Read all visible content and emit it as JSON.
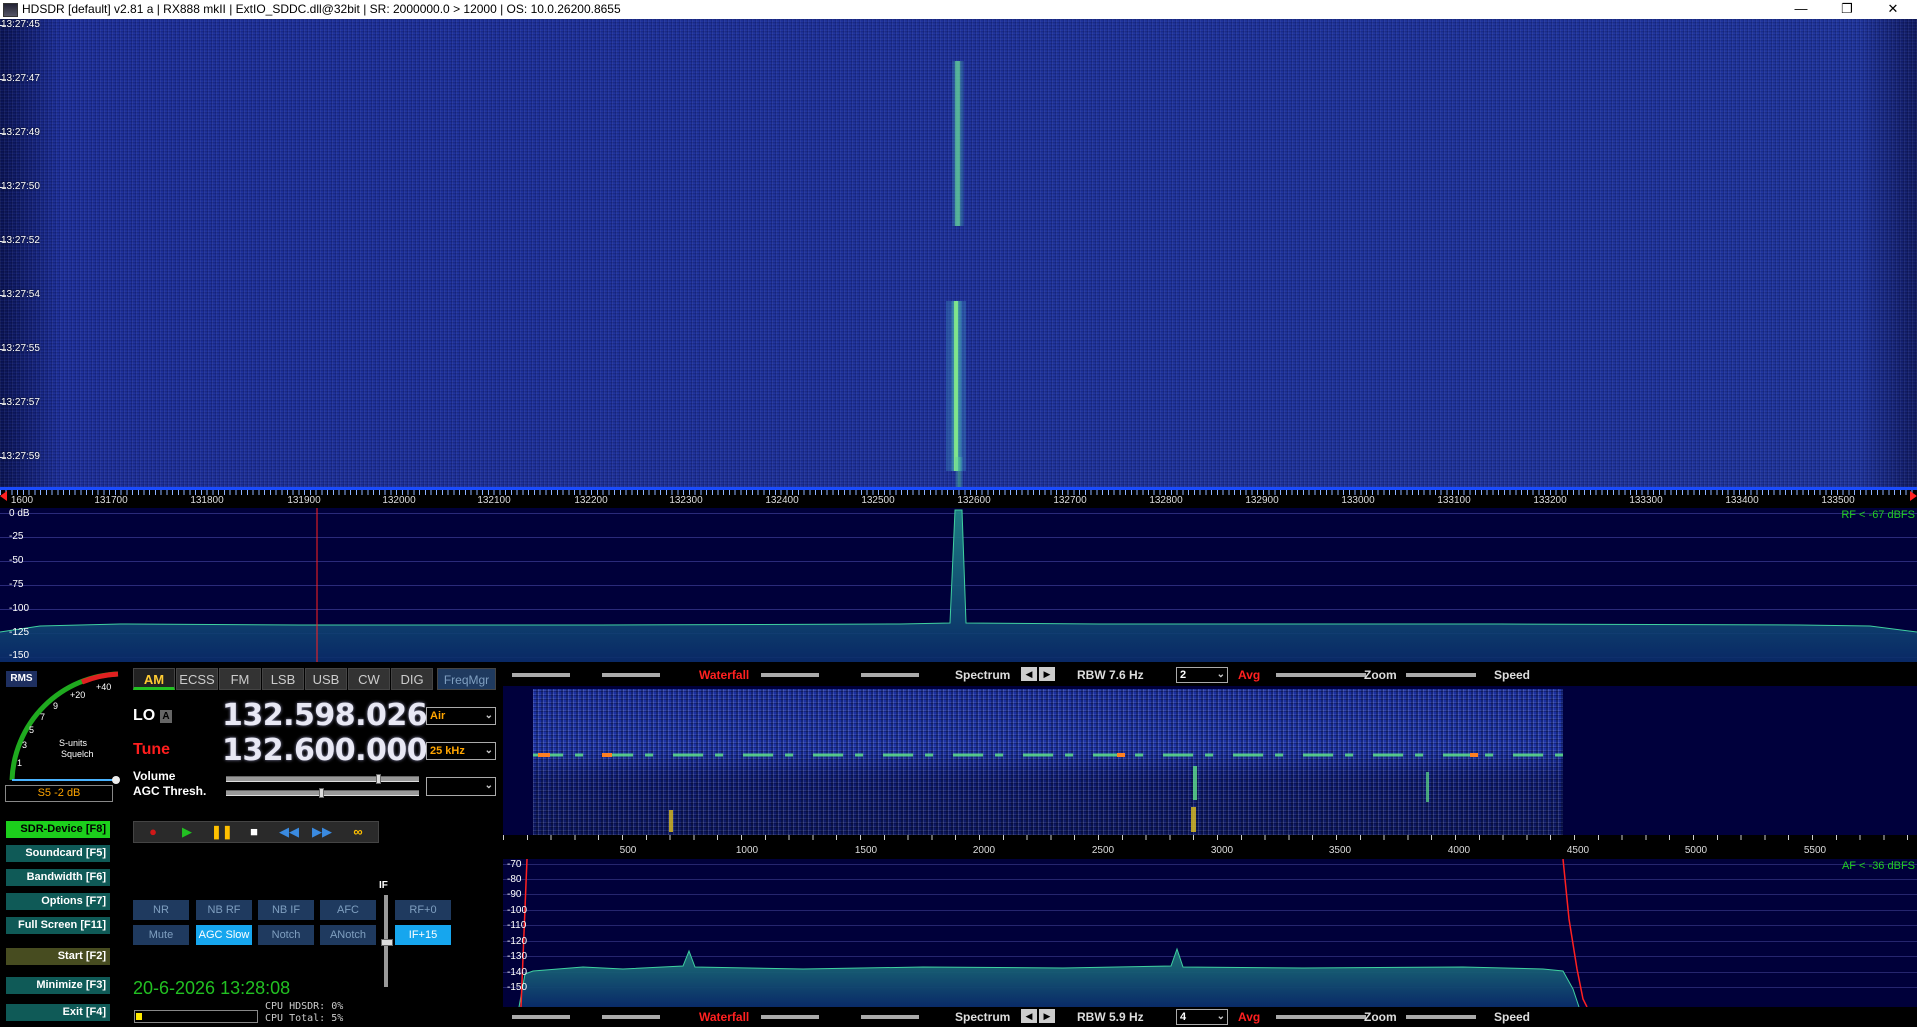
{
  "titlebar": {
    "title": "HDSDR  [default]  v2.81 a  |  RX888 mkII | ExtIO_SDDC.dll@32bit  |  SR: 2000000.0 > 12000  |  OS: 10.0.26200.8655",
    "minimize_glyph": "—",
    "maximize_glyph": "❐",
    "close_glyph": "✕"
  },
  "waterfall": {
    "timestamps": [
      "13:27:45",
      "13:27:47",
      "13:27:49",
      "13:27:50",
      "13:27:52",
      "13:27:54",
      "13:27:55",
      "13:27:57",
      "13:27:59"
    ]
  },
  "freq_scale": {
    "labels": [
      "1600",
      "131700",
      "131800",
      "131900",
      "132000",
      "132100",
      "132200",
      "132300",
      "132400",
      "132500",
      "132600",
      "132700",
      "132800",
      "132900",
      "133000",
      "133100",
      "133200",
      "133300",
      "133400",
      "133500"
    ]
  },
  "spectrum": {
    "levels": [
      "0 dB",
      "-25",
      "-50",
      "-75",
      "-100",
      "-125",
      "-150"
    ],
    "rf_readout": "RF < -67 dBFS"
  },
  "smeter": {
    "rms_label": "RMS",
    "scale_labels": [
      "1",
      "3",
      "5",
      "7",
      "9",
      "+20",
      "+40"
    ],
    "caption1": "S-units",
    "caption2": "Squelch",
    "reading": "S5 -2 dB"
  },
  "modes": [
    "AM",
    "ECSS",
    "FM",
    "LSB",
    "USB",
    "CW",
    "DIG"
  ],
  "freqmgr_label": "FreqMgr",
  "lo": {
    "label": "LO",
    "badge": "A",
    "value": "132.598.026",
    "dropdown": "Air"
  },
  "tune": {
    "label": "Tune",
    "value": "132.600.000",
    "dropdown": "25 kHz"
  },
  "volume_label": "Volume",
  "agc_label": "AGC Thresh.",
  "side_buttons": [
    "SDR-Device  [F8]",
    "Soundcard  [F5]",
    "Bandwidth  [F6]",
    "Options  [F7]",
    "Full Screen  [F11]",
    "Start  [F2]",
    "Minimize  [F3]",
    "Exit  [F4]"
  ],
  "transport_icons": [
    "record-icon",
    "play-icon",
    "pause-icon",
    "stop-icon",
    "rewind-icon",
    "fast-forward-icon",
    "loop-icon"
  ],
  "dsp_row1": [
    "NR",
    "NB RF",
    "NB IF",
    "AFC",
    "RF+0"
  ],
  "dsp_row2": [
    "Mute",
    "AGC Slow",
    "Notch",
    "ANotch",
    "IF+15"
  ],
  "if_label": "IF",
  "datetime": "20-6-2026 13:28:08",
  "cpu": {
    "hdsdr": "CPU HDSDR:  0%",
    "total": "CPU Total:  5%"
  },
  "audio_toolbar": {
    "waterfall": "Waterfall",
    "spectrum": "Spectrum",
    "rbw_top": "RBW  7.6 Hz",
    "rbw_bot": "RBW  5.9 Hz",
    "avg_top": "2",
    "avg_bot": "4",
    "avg": "Avg",
    "zoom": "Zoom",
    "speed": "Speed"
  },
  "audio_scale": {
    "labels": [
      "500",
      "1000",
      "1500",
      "2000",
      "2500",
      "3000",
      "3500",
      "4000",
      "4500",
      "5000",
      "5500"
    ]
  },
  "audio_spectrum": {
    "levels": [
      "-70",
      "-80",
      "-90",
      "-100",
      "-110",
      "-120",
      "-130",
      "-140",
      "-150"
    ],
    "af_readout": "AF < -36 dBFS"
  },
  "colors": {
    "accent_green": "#22c022",
    "tune_red": "#ff1e1e",
    "mode_active": "#ffcc33",
    "dsp_on": "#16a6ee",
    "waterfall_blue": "#1e3398"
  }
}
